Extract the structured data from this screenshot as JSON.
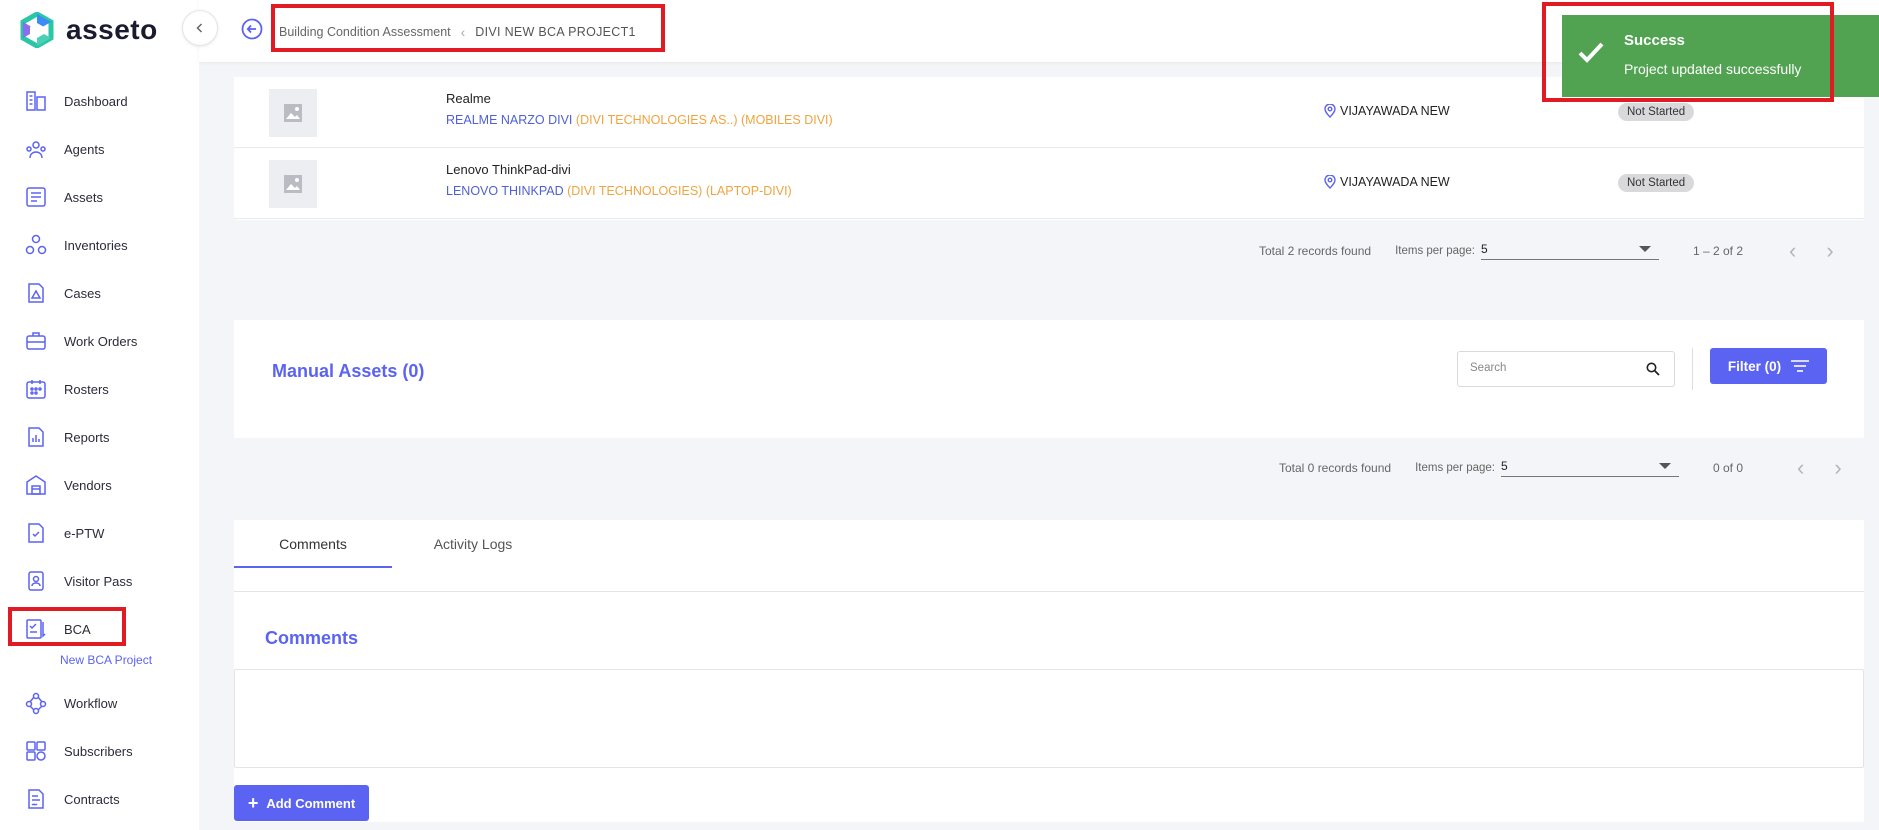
{
  "app": {
    "name": "asseto"
  },
  "header": {
    "breadcrumb": [
      "Building Condition Assessment",
      "DIVI NEW BCA PROJECT1"
    ]
  },
  "sidebar": {
    "items": [
      {
        "label": "Dashboard",
        "icon": "dashboard-icon"
      },
      {
        "label": "Agents",
        "icon": "agents-icon"
      },
      {
        "label": "Assets",
        "icon": "assets-icon"
      },
      {
        "label": "Inventories",
        "icon": "inventories-icon"
      },
      {
        "label": "Cases",
        "icon": "cases-icon"
      },
      {
        "label": "Work Orders",
        "icon": "work-orders-icon"
      },
      {
        "label": "Rosters",
        "icon": "rosters-icon"
      },
      {
        "label": "Reports",
        "icon": "reports-icon"
      },
      {
        "label": "Vendors",
        "icon": "vendors-icon"
      },
      {
        "label": "e-PTW",
        "icon": "eptw-icon"
      },
      {
        "label": "Visitor Pass",
        "icon": "visitor-pass-icon"
      },
      {
        "label": "BCA",
        "icon": "bca-icon"
      },
      {
        "label": "Workflow",
        "icon": "workflow-icon"
      },
      {
        "label": "Subscribers",
        "icon": "subscribers-icon"
      },
      {
        "label": "Contracts",
        "icon": "contracts-icon"
      }
    ],
    "bca_sub_item": "New BCA Project"
  },
  "assets": {
    "rows": [
      {
        "name": "Realme",
        "model": "REALME NARZO DIVI",
        "company": "(DIVI TECHNOLOGIES AS..)",
        "category": "(MOBILES DIVI)",
        "location": "VIJAYAWADA NEW",
        "status": "Not Started"
      },
      {
        "name": "Lenovo ThinkPad-divi",
        "model": "LENOVO THINKPAD",
        "company": "(DIVI TECHNOLOGIES)",
        "category": "(LAPTOP-DIVI)",
        "location": "VIJAYAWADA NEW",
        "status": "Not Started"
      }
    ],
    "pager": {
      "total": "Total 2 records found",
      "items_label": "Items per page:",
      "items_value": "5",
      "range": "1 – 2 of 2"
    }
  },
  "manual_assets": {
    "title": "Manual Assets (0)",
    "search_placeholder": "Search",
    "filter_label": "Filter  (0)",
    "pager": {
      "total": "Total 0 records found",
      "items_label": "Items per page:",
      "items_value": "5",
      "range": "0 of 0"
    }
  },
  "tabs": [
    {
      "label": "Comments",
      "active": true
    },
    {
      "label": "Activity Logs",
      "active": false
    }
  ],
  "comments": {
    "title": "Comments",
    "value": "",
    "add_button": "Add Comment"
  },
  "toast": {
    "title": "Success",
    "message": "Project updated successfully"
  },
  "colors": {
    "accent": "#5b63f2",
    "toast_green": "#51a351",
    "highlight_red": "#e01b24",
    "orange_text": "#f0a440"
  }
}
